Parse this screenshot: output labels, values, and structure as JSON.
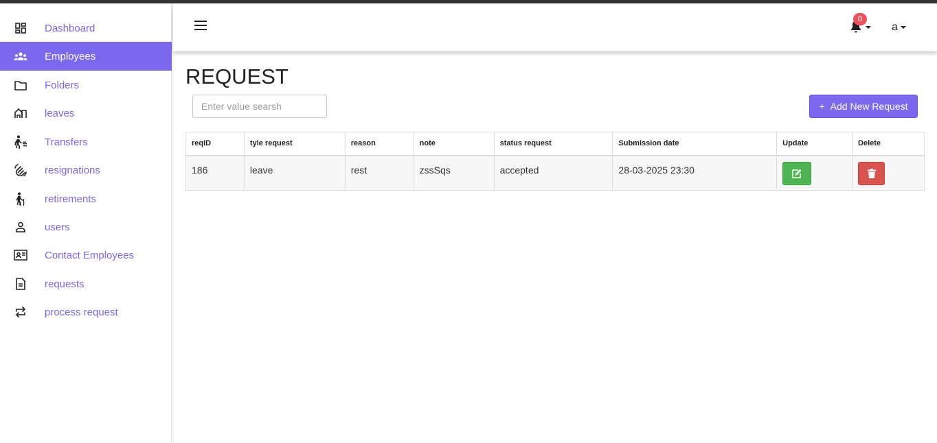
{
  "sidebar": {
    "items": [
      {
        "label": "Dashboard",
        "icon": "dashboard-icon",
        "active": false
      },
      {
        "label": "Employees",
        "icon": "people-icon",
        "active": true
      },
      {
        "label": "Folders",
        "icon": "folder-icon",
        "active": false
      },
      {
        "label": "leaves",
        "icon": "leave-icon",
        "active": false
      },
      {
        "label": "Transfers",
        "icon": "transfer-walk-icon",
        "active": false
      },
      {
        "label": "resignations",
        "icon": "hand-wave-icon",
        "active": false
      },
      {
        "label": "retirements",
        "icon": "elder-icon",
        "active": false
      },
      {
        "label": "users",
        "icon": "user-icon",
        "active": false
      },
      {
        "label": "Contact Employees",
        "icon": "contact-card-icon",
        "active": false
      },
      {
        "label": "requests",
        "icon": "document-icon",
        "active": false
      },
      {
        "label": "process request",
        "icon": "swap-icon",
        "active": false
      }
    ],
    "accent": "#7b68ee"
  },
  "header": {
    "notification_count": "0",
    "user_name": "a"
  },
  "main": {
    "title": "REQUEST",
    "search_placeholder": "Enter value searsh",
    "add_button_label": "Add New Request",
    "add_button_icon": "+"
  },
  "table": {
    "columns": [
      "reqID",
      "tyle request",
      "reason",
      "note",
      "status request",
      "Submission date",
      "Update",
      "Delete"
    ],
    "rows": [
      {
        "reqID": "186",
        "type": "leave",
        "reason": "rest",
        "note": "zssSqs",
        "status": "accepted",
        "date": "28-03-2025 23:30"
      }
    ]
  },
  "colors": {
    "update": "#4cb54f",
    "delete": "#d9534f",
    "badge": "#f0505a"
  }
}
